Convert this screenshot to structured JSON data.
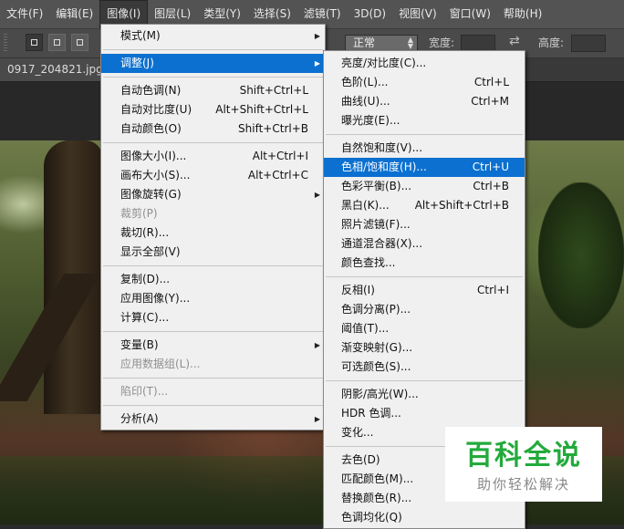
{
  "menubar": {
    "items": [
      "文件(F)",
      "编辑(E)",
      "图像(I)",
      "图层(L)",
      "类型(Y)",
      "选择(S)",
      "滤镜(T)",
      "3D(D)",
      "视图(V)",
      "窗口(W)",
      "帮助(H)"
    ]
  },
  "options": {
    "mode_value": "正常",
    "width_label": "宽度:",
    "height_label": "高度:"
  },
  "document": {
    "tab_label": "0917_204821.jpg @"
  },
  "image_menu": {
    "items": [
      {
        "label": "模式(M)",
        "shortcut": "",
        "submenu": true
      },
      {
        "label": "调整(J)",
        "shortcut": "",
        "submenu": true
      },
      {
        "label": "自动色调(N)",
        "shortcut": "Shift+Ctrl+L"
      },
      {
        "label": "自动对比度(U)",
        "shortcut": "Alt+Shift+Ctrl+L"
      },
      {
        "label": "自动颜色(O)",
        "shortcut": "Shift+Ctrl+B"
      },
      {
        "label": "图像大小(I)...",
        "shortcut": "Alt+Ctrl+I"
      },
      {
        "label": "画布大小(S)...",
        "shortcut": "Alt+Ctrl+C"
      },
      {
        "label": "图像旋转(G)",
        "shortcut": "",
        "submenu": true
      },
      {
        "label": "裁剪(P)",
        "shortcut": "",
        "disabled": true
      },
      {
        "label": "裁切(R)...",
        "shortcut": ""
      },
      {
        "label": "显示全部(V)",
        "shortcut": ""
      },
      {
        "label": "复制(D)...",
        "shortcut": ""
      },
      {
        "label": "应用图像(Y)...",
        "shortcut": ""
      },
      {
        "label": "计算(C)...",
        "shortcut": ""
      },
      {
        "label": "变量(B)",
        "shortcut": "",
        "submenu": true
      },
      {
        "label": "应用数据组(L)...",
        "shortcut": "",
        "disabled": true
      },
      {
        "label": "陷印(T)...",
        "shortcut": "",
        "disabled": true
      },
      {
        "label": "分析(A)",
        "shortcut": "",
        "submenu": true
      }
    ]
  },
  "adjust_menu": {
    "items": [
      {
        "label": "亮度/对比度(C)...",
        "shortcut": ""
      },
      {
        "label": "色阶(L)...",
        "shortcut": "Ctrl+L"
      },
      {
        "label": "曲线(U)...",
        "shortcut": "Ctrl+M"
      },
      {
        "label": "曝光度(E)...",
        "shortcut": ""
      },
      {
        "label": "自然饱和度(V)...",
        "shortcut": ""
      },
      {
        "label": "色相/饱和度(H)...",
        "shortcut": "Ctrl+U"
      },
      {
        "label": "色彩平衡(B)...",
        "shortcut": "Ctrl+B"
      },
      {
        "label": "黑白(K)...",
        "shortcut": "Alt+Shift+Ctrl+B"
      },
      {
        "label": "照片滤镜(F)...",
        "shortcut": ""
      },
      {
        "label": "通道混合器(X)...",
        "shortcut": ""
      },
      {
        "label": "颜色查找...",
        "shortcut": ""
      },
      {
        "label": "反相(I)",
        "shortcut": "Ctrl+I"
      },
      {
        "label": "色调分离(P)...",
        "shortcut": ""
      },
      {
        "label": "阈值(T)...",
        "shortcut": ""
      },
      {
        "label": "渐变映射(G)...",
        "shortcut": ""
      },
      {
        "label": "可选颜色(S)...",
        "shortcut": ""
      },
      {
        "label": "阴影/高光(W)...",
        "shortcut": ""
      },
      {
        "label": "HDR 色调...",
        "shortcut": ""
      },
      {
        "label": "变化...",
        "shortcut": ""
      },
      {
        "label": "去色(D)",
        "shortcut": "S"
      },
      {
        "label": "匹配颜色(M)...",
        "shortcut": ""
      },
      {
        "label": "替换颜色(R)...",
        "shortcut": ""
      },
      {
        "label": "色调均化(Q)",
        "shortcut": ""
      }
    ]
  },
  "watermark": {
    "title": "百科全说",
    "subtitle": "助你轻松解决"
  },
  "colors": {
    "highlight": "#0b70d0",
    "menubar": "#535353",
    "watermark_green": "#23aa3c"
  }
}
